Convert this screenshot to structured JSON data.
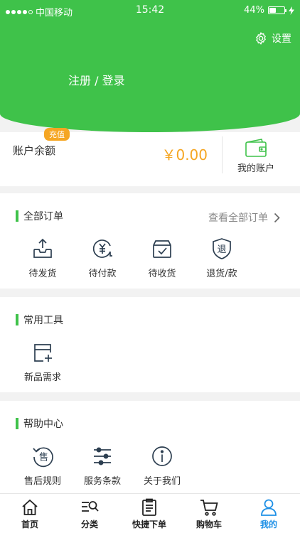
{
  "status_bar": {
    "carrier": "中国移动",
    "time": "15:42",
    "battery": "44%",
    "battery_level": 0.44
  },
  "header": {
    "settings_label": "设置",
    "login_label": "注册 / 登录"
  },
  "account": {
    "badge": "充值",
    "balance_label": "账户余额",
    "balance_value": "￥0.00",
    "my_account_label": "我的账户"
  },
  "orders": {
    "title": "全部订单",
    "view_all": "查看全部订单",
    "items": [
      {
        "label": "待发货",
        "icon": "outbox-tray-icon"
      },
      {
        "label": "待付款",
        "icon": "yuan-clock-icon"
      },
      {
        "label": "待收货",
        "icon": "delivery-box-icon"
      },
      {
        "label": "退货/款",
        "icon": "return-shield-icon"
      }
    ]
  },
  "tools": {
    "title": "常用工具",
    "items": [
      {
        "label": "新品需求",
        "icon": "new-product-icon"
      }
    ]
  },
  "help": {
    "title": "帮助中心",
    "items": [
      {
        "label": "售后规则",
        "icon": "after-sale-icon"
      },
      {
        "label": "服务条款",
        "icon": "sliders-icon"
      },
      {
        "label": "关于我们",
        "icon": "info-icon"
      }
    ]
  },
  "tabbar": {
    "items": [
      {
        "label": "首页",
        "icon": "home-icon"
      },
      {
        "label": "分类",
        "icon": "category-search-icon"
      },
      {
        "label": "快捷下单",
        "icon": "quick-order-icon"
      },
      {
        "label": "购物车",
        "icon": "cart-icon"
      },
      {
        "label": "我的",
        "icon": "user-icon"
      }
    ],
    "active_color": "#1e90e6"
  },
  "colors": {
    "brand_green": "#3fc24a",
    "amount_orange": "#f5a623"
  }
}
